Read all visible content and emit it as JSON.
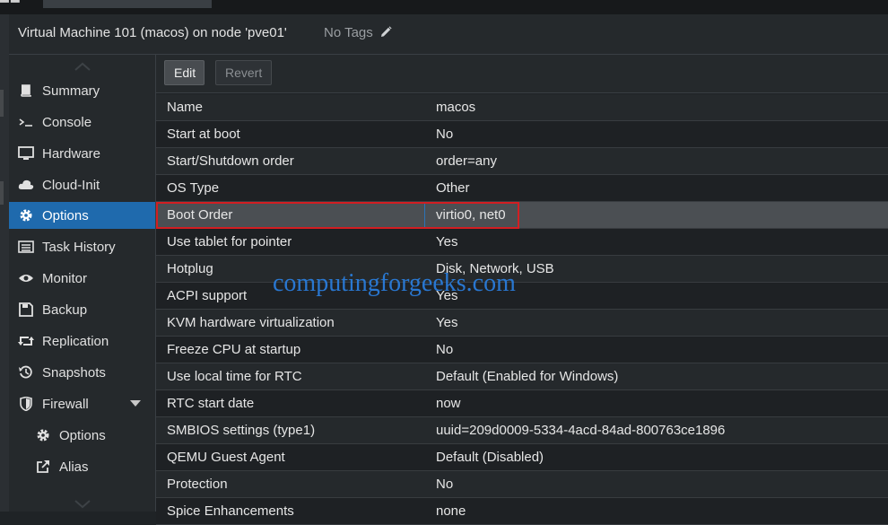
{
  "header": {
    "title": "Virtual Machine 101 (macos) on node 'pve01'",
    "tags_label": "No Tags"
  },
  "sidebar": {
    "items": [
      {
        "label": "Summary",
        "icon": "book-icon"
      },
      {
        "label": "Console",
        "icon": "terminal-icon"
      },
      {
        "label": "Hardware",
        "icon": "monitor-icon"
      },
      {
        "label": "Cloud-Init",
        "icon": "cloud-icon"
      },
      {
        "label": "Options",
        "icon": "gear-icon",
        "active": true
      },
      {
        "label": "Task History",
        "icon": "list-icon"
      },
      {
        "label": "Monitor",
        "icon": "eye-icon"
      },
      {
        "label": "Backup",
        "icon": "floppy-icon"
      },
      {
        "label": "Replication",
        "icon": "retweet-icon"
      },
      {
        "label": "Snapshots",
        "icon": "history-icon"
      },
      {
        "label": "Firewall",
        "icon": "shield-icon"
      },
      {
        "label": "Options",
        "icon": "gear-icon"
      },
      {
        "label": "Alias",
        "icon": "external-link-icon"
      }
    ]
  },
  "toolbar": {
    "edit_label": "Edit",
    "revert_label": "Revert"
  },
  "options": {
    "rows": [
      {
        "key": "Name",
        "value": "macos"
      },
      {
        "key": "Start at boot",
        "value": "No"
      },
      {
        "key": "Start/Shutdown order",
        "value": "order=any"
      },
      {
        "key": "OS Type",
        "value": "Other"
      },
      {
        "key": "Boot Order",
        "value": "virtio0, net0"
      },
      {
        "key": "Use tablet for pointer",
        "value": "Yes"
      },
      {
        "key": "Hotplug",
        "value": "Disk, Network, USB"
      },
      {
        "key": "ACPI support",
        "value": "Yes"
      },
      {
        "key": "KVM hardware virtualization",
        "value": "Yes"
      },
      {
        "key": "Freeze CPU at startup",
        "value": "No"
      },
      {
        "key": "Use local time for RTC",
        "value": "Default (Enabled for Windows)"
      },
      {
        "key": "RTC start date",
        "value": "now"
      },
      {
        "key": "SMBIOS settings (type1)",
        "value": "uuid=209d0009-5334-4acd-84ad-800763ce1896"
      },
      {
        "key": "QEMU Guest Agent",
        "value": "Default (Disabled)"
      },
      {
        "key": "Protection",
        "value": "No"
      },
      {
        "key": "Spice Enhancements",
        "value": "none"
      }
    ]
  },
  "watermark": "computingforgeeks.com",
  "colors": {
    "accent": "#1f6aad",
    "highlight_border": "#d21e22",
    "watermark": "#2a7fe0"
  }
}
